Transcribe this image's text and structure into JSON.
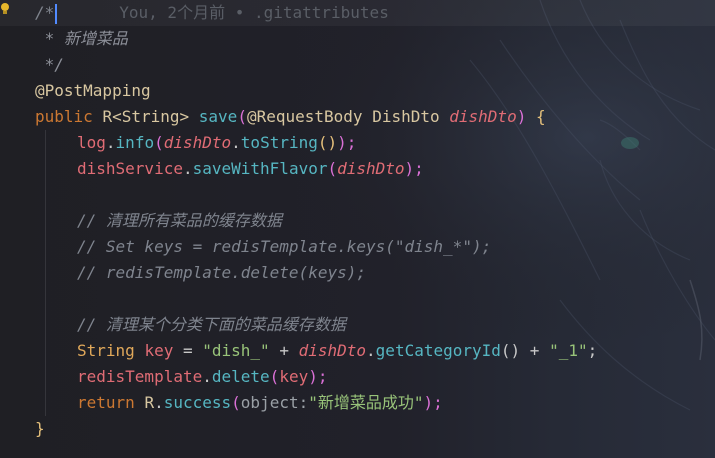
{
  "editor": {
    "file_hint": ".gitattributes",
    "blame": "You, 2个月前 • .gitattributes",
    "lines": {
      "l1_open": "/*",
      "l2_doc": " * 新增菜品",
      "l3_close": " */",
      "l4_annotation": "@PostMapping",
      "l5": {
        "kw_public": "public",
        "type_r": "R<String>",
        "method": "save",
        "open": "(",
        "ann": "@RequestBody",
        "param_type": "DishDto",
        "param": "dishDto",
        "close": ")",
        "brace": "{"
      },
      "l6": {
        "field": "log",
        "dot1": ".",
        "method": "info",
        "open": "(",
        "param": "dishDto",
        "dot2": ".",
        "method2": "toString",
        "call": "()",
        "close": ");"
      },
      "l7": {
        "field": "dishService",
        "dot": ".",
        "method": "saveWithFlavor",
        "open": "(",
        "param": "dishDto",
        "close": ");"
      },
      "l9_comment": "// 清理所有菜品的缓存数据",
      "l10_comment": "// Set keys = redisTemplate.keys(\"dish_*\");",
      "l11_comment": "// redisTemplate.delete(keys);",
      "l13_comment": "// 清理某个分类下面的菜品缓存数据",
      "l14": {
        "type": "String",
        "var": "key",
        "eq": " = ",
        "str1": "\"dish_\"",
        "plus1": " + ",
        "param": "dishDto",
        "dot": ".",
        "method": "getCategoryId",
        "call": "()",
        "plus2": " + ",
        "str2": "\"_1\"",
        "end": ";"
      },
      "l15": {
        "field": "redisTemplate",
        "dot": ".",
        "method": "delete",
        "open": "(",
        "var": "key",
        "close": ");"
      },
      "l16": {
        "kw": "return",
        "cls": "R",
        "dot": ".",
        "method": "success",
        "open": "(",
        "hint": "object:",
        "str": "\"新增菜品成功\"",
        "close": ");"
      },
      "l17_brace": "}"
    },
    "colors": {
      "background": "#1f1f24",
      "keyword": "#cc7832",
      "function": "#56b6c2",
      "field": "#e06c75",
      "string": "#98c379",
      "comment": "#7f848e",
      "caret": "#528bff"
    },
    "icons": {
      "gutter": "lightbulb-icon"
    }
  }
}
